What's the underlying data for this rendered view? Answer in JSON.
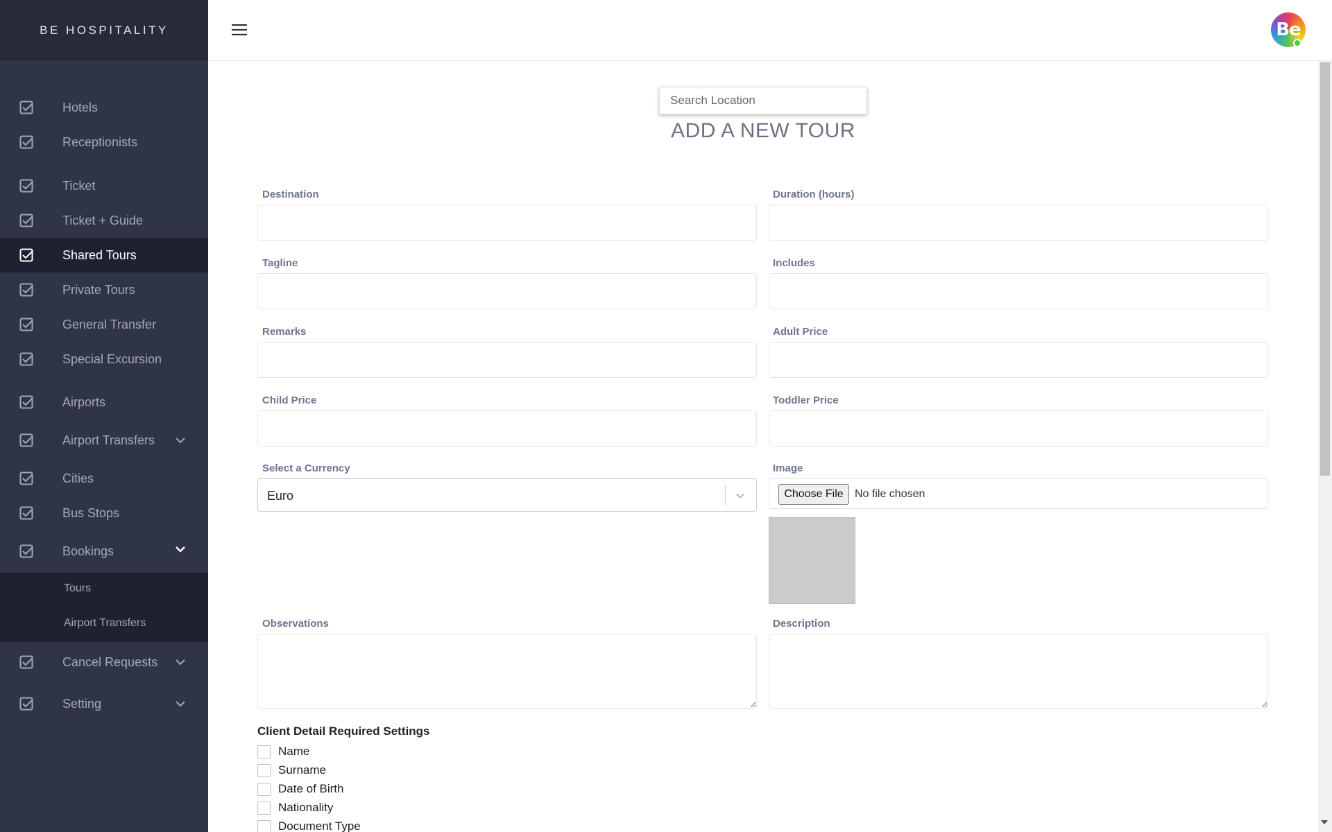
{
  "brand": "BE HOSPITALITY",
  "avatar_text": "Be",
  "sidebar": {
    "items": [
      {
        "label": "Hotels",
        "icon": "checkbox-icon"
      },
      {
        "label": "Receptionists",
        "icon": "checkbox-icon"
      },
      {
        "label": "Ticket",
        "icon": "checkbox-icon"
      },
      {
        "label": "Ticket + Guide",
        "icon": "checkbox-icon"
      },
      {
        "label": "Shared Tours",
        "icon": "checkbox-icon",
        "active": true
      },
      {
        "label": "Private Tours",
        "icon": "checkbox-icon"
      },
      {
        "label": "General Transfer",
        "icon": "checkbox-icon"
      },
      {
        "label": "Special Excursion",
        "icon": "checkbox-icon"
      },
      {
        "label": "Airports",
        "icon": "checkbox-icon"
      },
      {
        "label": "Airport Transfers",
        "icon": "checkbox-icon",
        "expandable": true
      },
      {
        "label": "Cities",
        "icon": "checkbox-icon"
      },
      {
        "label": "Bus Stops",
        "icon": "checkbox-icon"
      },
      {
        "label": "Bookings",
        "icon": "checkbox-icon",
        "expandable": true,
        "expanded": true
      },
      {
        "label": "Cancel Requests",
        "icon": "checkbox-icon",
        "expandable": true
      },
      {
        "label": "Setting",
        "icon": "checkbox-icon",
        "expandable": true
      }
    ],
    "bookings_sub": [
      "Tours",
      "Airport Transfers"
    ]
  },
  "search": {
    "placeholder": "Search Location"
  },
  "page_title": "ADD A NEW TOUR",
  "form": {
    "destination": "Destination",
    "duration": "Duration (hours)",
    "tagline": "Tagline",
    "includes": "Includes",
    "remarks": "Remarks",
    "adult_price": "Adult Price",
    "child_price": "Child Price",
    "toddler_price": "Toddler Price",
    "currency_label": "Select a Currency",
    "currency_value": "Euro",
    "image_label": "Image",
    "file_button": "Choose File",
    "file_status": "No file chosen",
    "observations": "Observations",
    "description": "Description"
  },
  "client_settings": {
    "title": "Client Detail Required Settings",
    "options": [
      "Name",
      "Surname",
      "Date of Birth",
      "Nationality",
      "Document Type"
    ]
  },
  "colors": {
    "sidebar_bg": "#2f3446",
    "sidebar_active_bg": "#1e2230",
    "accent": "#6d7490"
  }
}
